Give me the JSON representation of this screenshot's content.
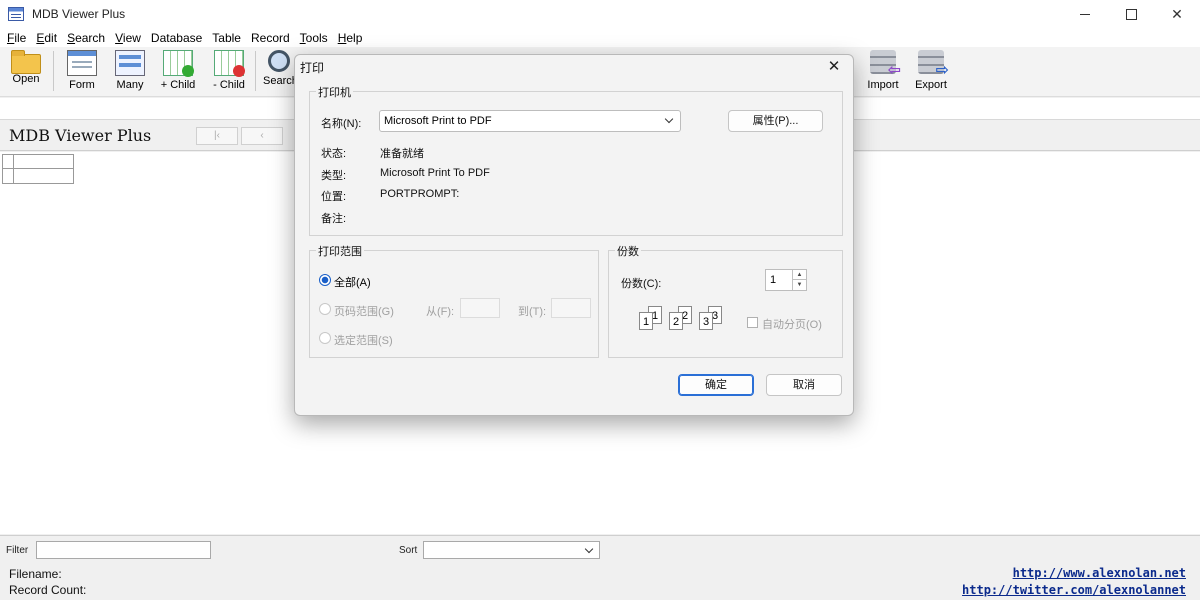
{
  "window": {
    "title": "MDB Viewer Plus"
  },
  "menu": [
    {
      "u": "F",
      "rest": "ile"
    },
    {
      "u": "E",
      "rest": "dit"
    },
    {
      "u": "S",
      "rest": "earch"
    },
    {
      "u": "V",
      "rest": "iew"
    },
    {
      "u": "",
      "rest": "Database"
    },
    {
      "u": "",
      "rest": "Table"
    },
    {
      "u": "",
      "rest": "Record"
    },
    {
      "u": "T",
      "rest": "ools"
    },
    {
      "u": "H",
      "rest": "elp"
    }
  ],
  "toolbar": {
    "open": "Open",
    "form": "Form",
    "many": "Many",
    "add_child": "+ Child",
    "remove_child": "- Child",
    "search": "Search",
    "import": "Import",
    "export": "Export"
  },
  "main": {
    "heading": "MDB Viewer Plus"
  },
  "bottom": {
    "filter_label": "Filter",
    "sort_label": "Sort",
    "filename_label": "Filename:",
    "record_count_label": "Record Count:",
    "link1": "http://www.alexnolan.net",
    "link2": "http://twitter.com/alexnolannet"
  },
  "dialog": {
    "title": "打印",
    "printer_group": "打印机",
    "name_label": "名称(N):",
    "printer_name": "Microsoft Print to PDF",
    "properties_button": "属性(P)...",
    "status_label": "状态:",
    "status_value": "准备就绪",
    "type_label": "类型:",
    "type_value": "Microsoft Print To PDF",
    "where_label": "位置:",
    "where_value": "PORTPROMPT:",
    "comment_label": "备注:",
    "range_group": "打印范围",
    "range_all": "全部(A)",
    "range_pages": "页码范围(G)",
    "from_label": "从(F):",
    "to_label": "到(T):",
    "range_selection": "选定范围(S)",
    "copies_group": "份数",
    "copies_label": "份数(C):",
    "copies_value": "1",
    "collate_label": "自动分页(O)",
    "ok_button": "确定",
    "cancel_button": "取消"
  }
}
